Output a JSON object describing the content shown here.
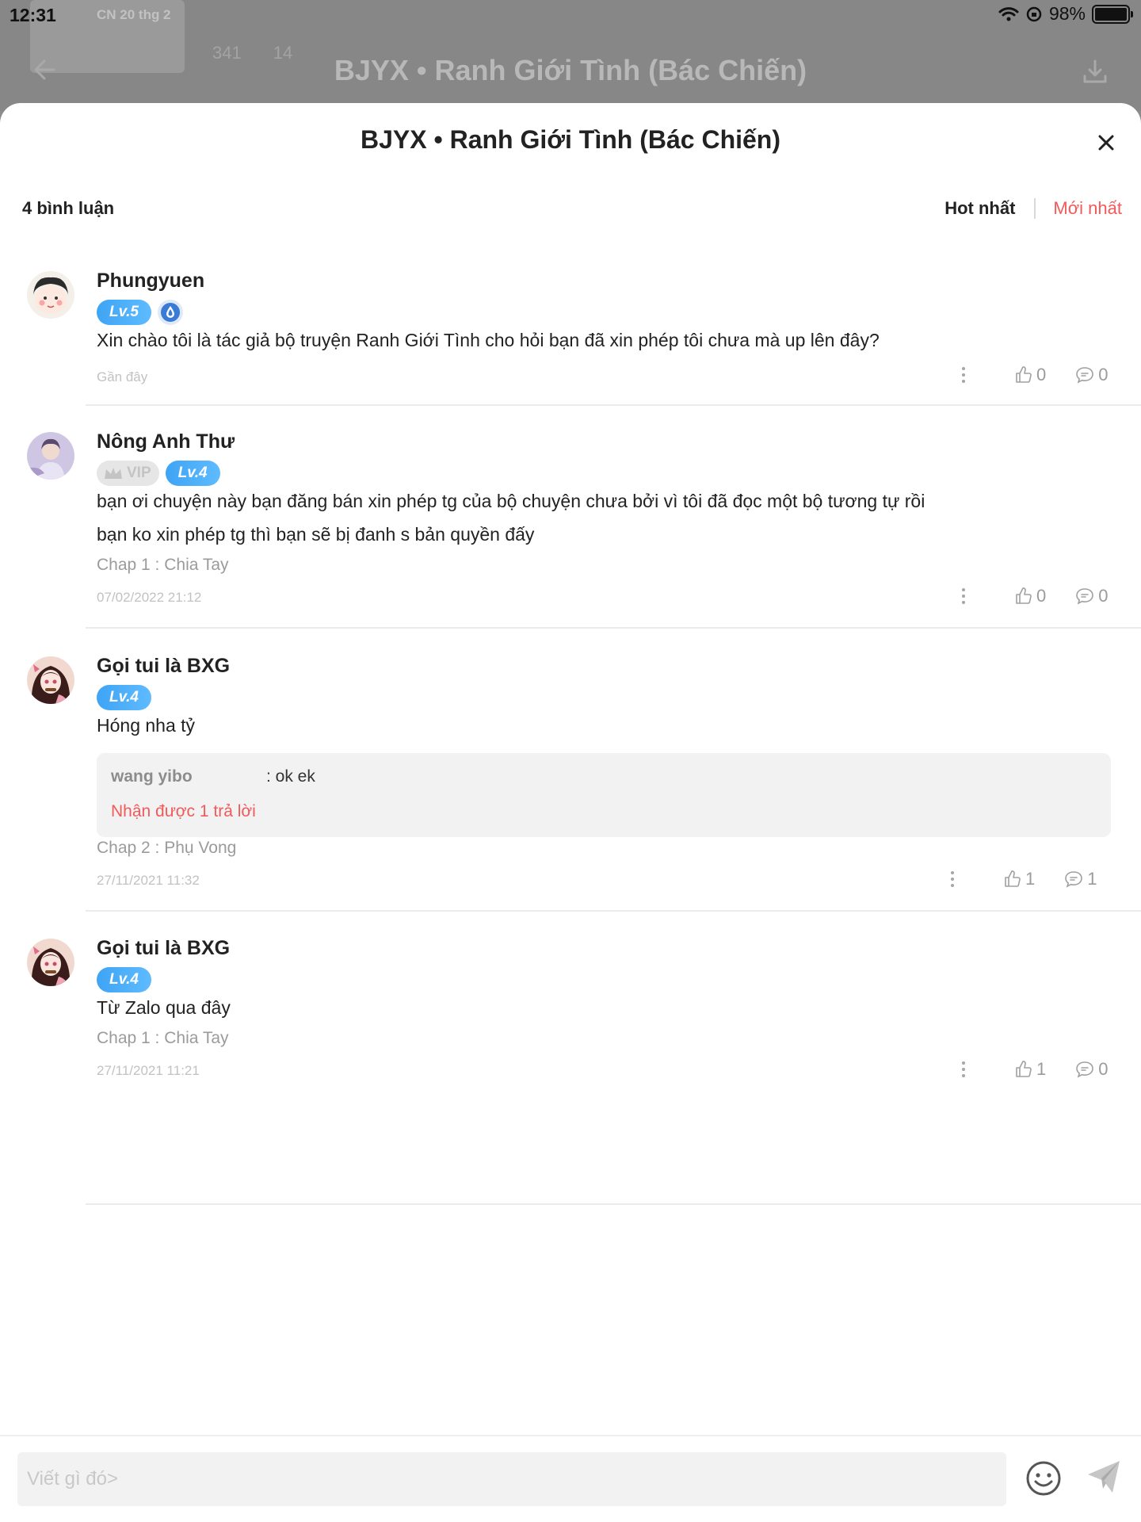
{
  "status_bar": {
    "time": "12:31",
    "date": "CN 20 thg 2",
    "battery": "98%"
  },
  "background": {
    "title": "BJYX • Ranh Giới Tình (Bác Chiến)",
    "stat_likes": "341",
    "stat_comments": "14"
  },
  "sheet": {
    "title": "BJYX • Ranh Giới Tình (Bác Chiến)",
    "comment_count": "4 bình luận",
    "sort_hot": "Hot nhất",
    "sort_new": "Mới nhất"
  },
  "comments": [
    {
      "name": "Phungyuen",
      "level": "Lv.5",
      "text": "Xin chào tôi là tác giả bộ truyện Ranh Giới Tình cho hỏi bạn đã xin phép tôi chưa mà up lên đây?",
      "date": "Gần đây",
      "likes": "0",
      "replies": "0"
    },
    {
      "name": "Nông Anh Thư",
      "vip": "VIP",
      "level": "Lv.4",
      "text_line1": "bạn ơi chuyện này bạn đăng bán xin phép tg của bộ chuyện chưa bởi vì tôi đã đọc một bộ tương tự rồi",
      "text_line2": "bạn ko xin phép tg thì bạn sẽ bị đanh s bản quyền đấy",
      "chapter": "Chap 1 : Chia Tay",
      "date": "07/02/2022 21:12",
      "likes": "0",
      "replies": "0"
    },
    {
      "name": "Gọi tui là BXG",
      "level": "Lv.4",
      "text": "Hóng nha tỷ",
      "reply_user": "wang yibo",
      "reply_text": ": ok ek",
      "reply_count": "Nhận được 1 trả lời",
      "chapter": "Chap 2 : Phụ Vong",
      "date": "27/11/2021 11:32",
      "likes": "1",
      "replies": "1"
    },
    {
      "name": "Gọi tui là BXG",
      "level": "Lv.4",
      "text": "Từ Zalo qua đây",
      "chapter": "Chap 1 : Chia Tay",
      "date": "27/11/2021 11:21",
      "likes": "1",
      "replies": "0"
    }
  ],
  "input": {
    "placeholder": "Viết gì đó>"
  },
  "colors": {
    "accent": "#f25a5a",
    "level_badge": "#3ea4f5",
    "muted_text": "#9b9b9b"
  }
}
